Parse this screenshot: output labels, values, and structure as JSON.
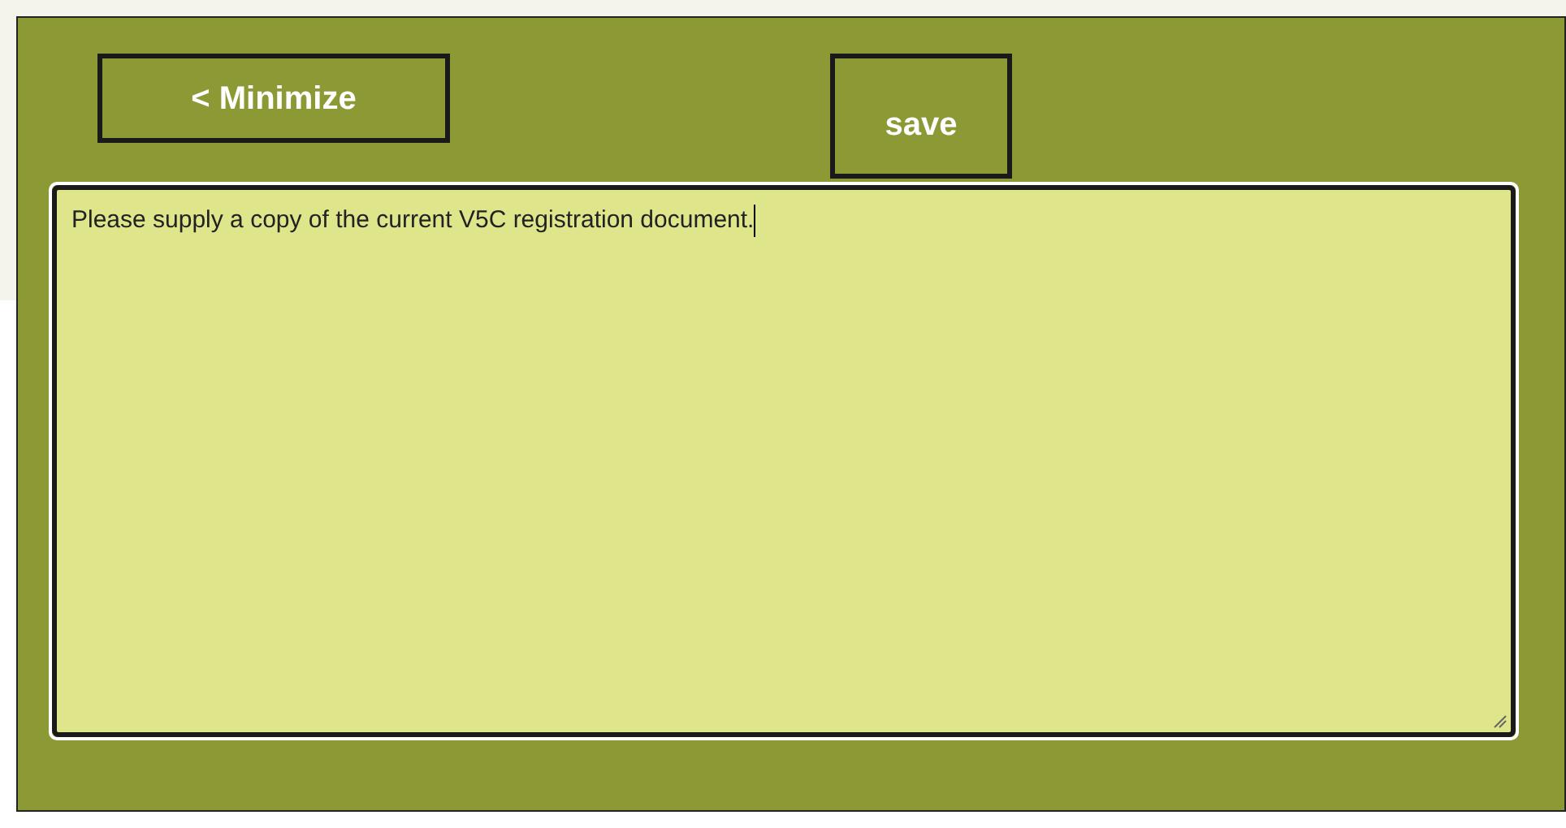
{
  "buttons": [
    {
      "label": "< Minimize",
      "kind": "minimize"
    },
    {
      "label": "save",
      "kind": "save"
    }
  ],
  "note": {
    "value": "Please supply a copy of the current V5C registration document.",
    "focused": true
  }
}
